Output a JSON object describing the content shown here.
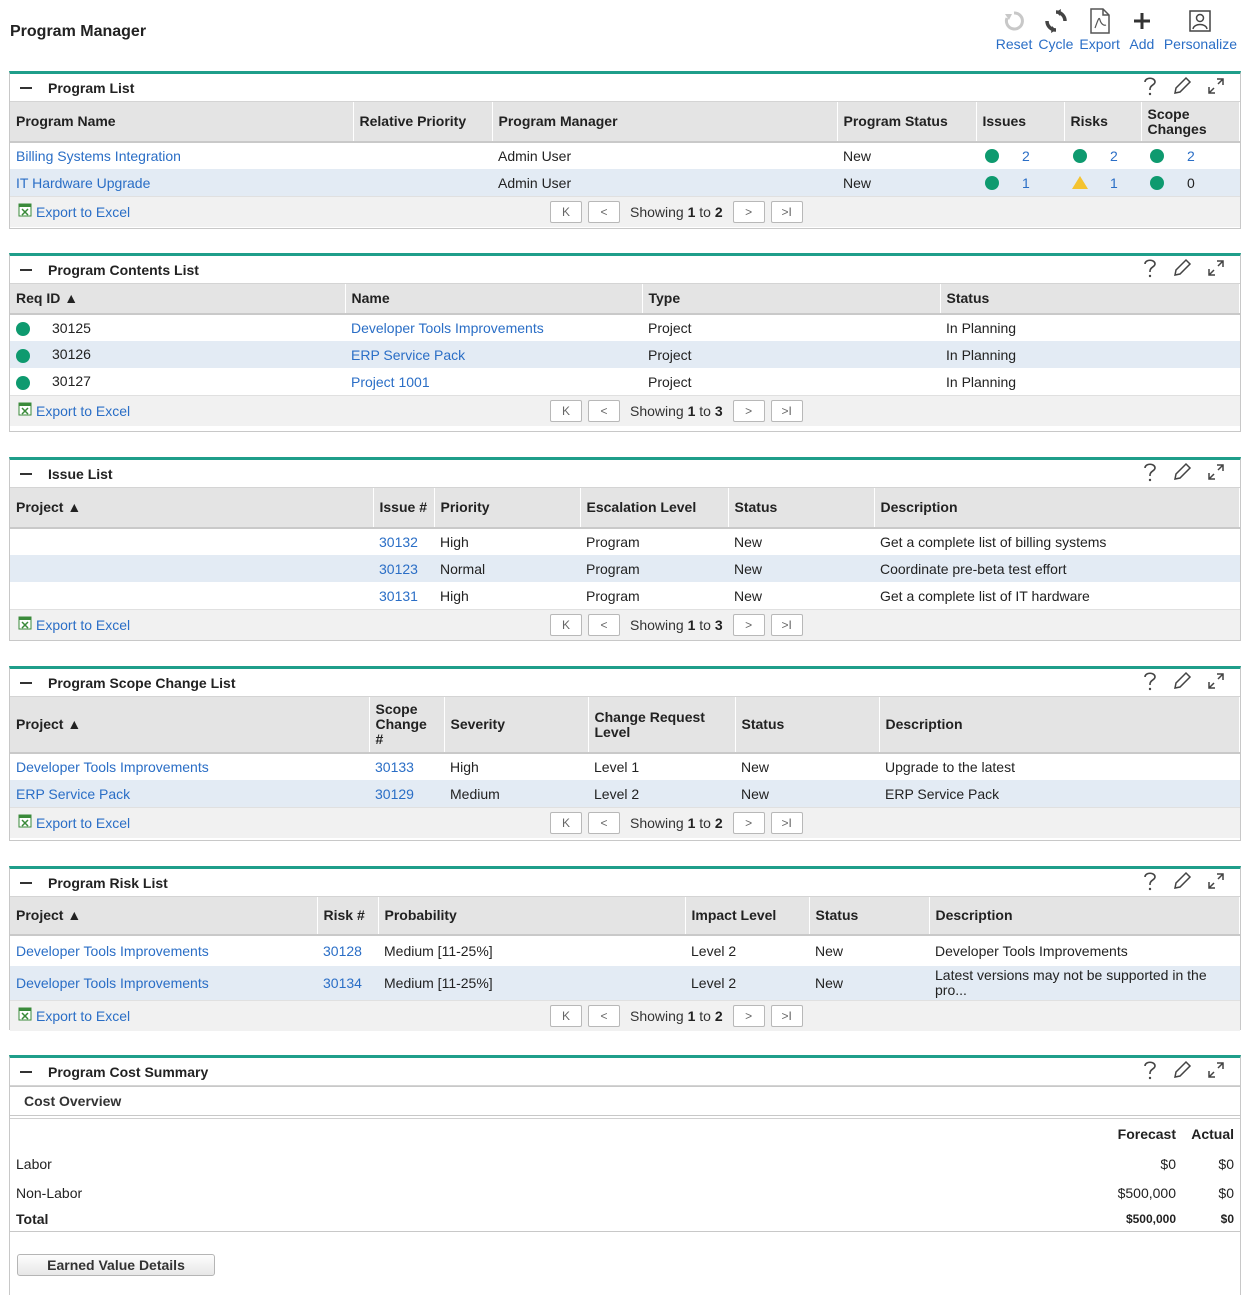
{
  "page": {
    "title": "Program Manager"
  },
  "toolbar": {
    "reset": "Reset",
    "cycle": "Cycle",
    "export": "Export",
    "add": "Add",
    "personalize": "Personalize"
  },
  "common": {
    "export_excel": "Export to Excel",
    "showing": "Showing",
    "first": "1",
    "to": "to"
  },
  "program_list": {
    "title": "Program List",
    "columns": [
      "Program Name",
      "Relative Priority",
      "Program Manager",
      "Program Status",
      "Issues",
      "Risks",
      "Scope Changes"
    ],
    "rows": [
      {
        "name": "Billing Systems Integration",
        "priority": "",
        "manager": "Admin User",
        "status": "New",
        "issues": "2",
        "issues_ind": "green",
        "risks": "2",
        "risks_ind": "green",
        "scope": "2",
        "scope_ind": "green"
      },
      {
        "name": "IT Hardware Upgrade",
        "priority": "",
        "manager": "Admin User",
        "status": "New",
        "issues": "1",
        "issues_ind": "green",
        "risks": "1",
        "risks_ind": "yellow",
        "scope": "0",
        "scope_ind": "green"
      }
    ],
    "total": "2"
  },
  "contents_list": {
    "title": "Program Contents List",
    "columns": [
      "Req ID ▲",
      "Name",
      "Type",
      "Status"
    ],
    "rows": [
      {
        "id": "30125",
        "name": "Developer Tools Improvements",
        "type": "Project",
        "status": "In Planning"
      },
      {
        "id": "30126",
        "name": "ERP Service Pack",
        "type": "Project",
        "status": "In Planning"
      },
      {
        "id": "30127",
        "name": "Project 1001",
        "type": "Project",
        "status": "In Planning"
      }
    ],
    "total": "3"
  },
  "issue_list": {
    "title": "Issue List",
    "columns": [
      "Project ▲",
      "Issue #",
      "Priority",
      "Escalation Level",
      "Status",
      "Description"
    ],
    "rows": [
      {
        "project": "",
        "num": "30132",
        "priority": "High",
        "level": "Program",
        "status": "New",
        "desc": "Get a complete list of billing systems"
      },
      {
        "project": "",
        "num": "30123",
        "priority": "Normal",
        "level": "Program",
        "status": "New",
        "desc": "Coordinate pre-beta test effort"
      },
      {
        "project": "",
        "num": "30131",
        "priority": "High",
        "level": "Program",
        "status": "New",
        "desc": "Get a complete list of IT hardware"
      }
    ],
    "total": "3"
  },
  "scope_list": {
    "title": "Program Scope Change List",
    "columns": [
      "Project ▲",
      "Scope Change #",
      "Severity",
      "Change Request Level",
      "Status",
      "Description"
    ],
    "rows": [
      {
        "project": "Developer Tools Improvements",
        "num": "30133",
        "severity": "High",
        "level": "Level 1",
        "status": "New",
        "desc": "Upgrade to the latest"
      },
      {
        "project": "ERP Service Pack",
        "num": "30129",
        "severity": "Medium",
        "level": "Level 2",
        "status": "New",
        "desc": "ERP Service Pack"
      }
    ],
    "total": "2"
  },
  "risk_list": {
    "title": "Program Risk List",
    "columns": [
      "Project ▲",
      "Risk #",
      "Probability",
      "Impact Level",
      "Status",
      "Description"
    ],
    "rows": [
      {
        "project": "Developer Tools Improvements",
        "num": "30128",
        "probability": "Medium [11-25%]",
        "impact": "Level 2",
        "status": "New",
        "desc": "Developer Tools Improvements"
      },
      {
        "project": "Developer Tools Improvements",
        "num": "30134",
        "probability": "Medium [11-25%]",
        "impact": "Level 2",
        "status": "New",
        "desc": "Latest versions may not be supported in the pro..."
      }
    ],
    "total": "2"
  },
  "cost_summary": {
    "title": "Program Cost Summary",
    "overview": "Cost Overview",
    "col_forecast": "Forecast",
    "col_actual": "Actual",
    "rows": [
      {
        "label": "Labor",
        "forecast": "$0",
        "actual": "$0"
      },
      {
        "label": "Non-Labor",
        "forecast": "$500,000",
        "actual": "$0"
      }
    ],
    "total": {
      "label": "Total",
      "forecast": "$500,000",
      "actual": "$0"
    },
    "ev_button": "Earned Value Details"
  },
  "colors": {
    "accent": "#1f9e8a",
    "link": "#2a6ec6",
    "green": "#0e9a6f",
    "yellow": "#f4c330",
    "alt_row": "#e3ebf4"
  }
}
